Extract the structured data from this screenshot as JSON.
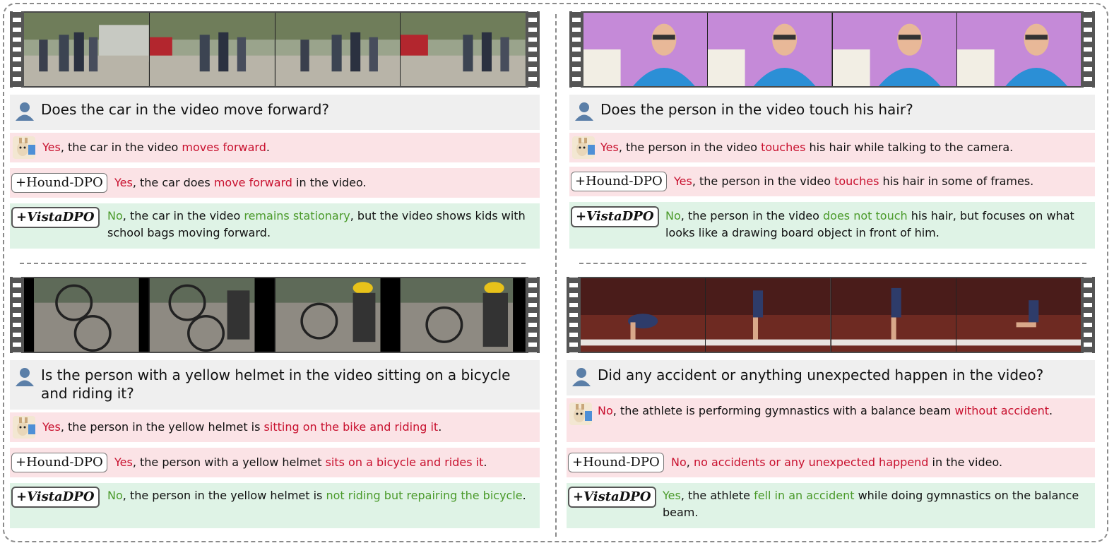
{
  "tags": {
    "hound": "+Hound-DPO",
    "vista": "+VistaDPO"
  },
  "panels": [
    {
      "question": "Does the car in the video move forward?",
      "base": [
        {
          "t": "Yes",
          "c": "red"
        },
        {
          "t": ", the car in the video ",
          "c": ""
        },
        {
          "t": "moves forward",
          "c": "red"
        },
        {
          "t": ".",
          "c": ""
        }
      ],
      "hound": [
        {
          "t": "Yes",
          "c": "red"
        },
        {
          "t": ", the car does ",
          "c": ""
        },
        {
          "t": "move forward",
          "c": "red"
        },
        {
          "t": " in the video.",
          "c": ""
        }
      ],
      "vista": [
        {
          "t": "No",
          "c": "grn"
        },
        {
          "t": ", the car in the video ",
          "c": ""
        },
        {
          "t": "remains stationary",
          "c": "grn"
        },
        {
          "t": ", but the video shows kids with school bags moving forward.",
          "c": ""
        }
      ]
    },
    {
      "question": "Does the person in the video touch his hair?",
      "base": [
        {
          "t": "Yes",
          "c": "red"
        },
        {
          "t": ", the person in the video ",
          "c": ""
        },
        {
          "t": "touches",
          "c": "red"
        },
        {
          "t": " his hair while talking to the camera.",
          "c": ""
        }
      ],
      "hound": [
        {
          "t": "Yes",
          "c": "red"
        },
        {
          "t": ", the person in the video ",
          "c": ""
        },
        {
          "t": "touches",
          "c": "red"
        },
        {
          "t": " his hair in some of frames.",
          "c": ""
        }
      ],
      "vista": [
        {
          "t": "No",
          "c": "grn"
        },
        {
          "t": ", the person in the video ",
          "c": ""
        },
        {
          "t": "does not touch",
          "c": "grn"
        },
        {
          "t": " his hair, but focuses on what looks like a drawing board object in front of him.",
          "c": ""
        }
      ]
    },
    {
      "question": "Is the person with a yellow helmet in the video sitting on a bicycle and riding it?",
      "base": [
        {
          "t": "Yes",
          "c": "red"
        },
        {
          "t": ", the person in the yellow helmet is ",
          "c": ""
        },
        {
          "t": "sitting on the bike and riding it",
          "c": "red"
        },
        {
          "t": ".",
          "c": ""
        }
      ],
      "hound": [
        {
          "t": "Yes",
          "c": "red"
        },
        {
          "t": ", the person with a yellow helmet ",
          "c": ""
        },
        {
          "t": "sits on a bicycle and rides it",
          "c": "red"
        },
        {
          "t": ".",
          "c": ""
        }
      ],
      "vista": [
        {
          "t": "No",
          "c": "grn"
        },
        {
          "t": ", the person in the yellow helmet is ",
          "c": ""
        },
        {
          "t": "not riding but repairing the bicycle",
          "c": "grn"
        },
        {
          "t": ".",
          "c": ""
        }
      ]
    },
    {
      "question": "Did any accident or anything unexpected happen in the video?",
      "base": [
        {
          "t": "No",
          "c": "red"
        },
        {
          "t": ", the athlete is performing gymnastics with a balance beam ",
          "c": ""
        },
        {
          "t": "without accident",
          "c": "red"
        },
        {
          "t": ".",
          "c": ""
        }
      ],
      "hound": [
        {
          "t": "No",
          "c": "red"
        },
        {
          "t": ", ",
          "c": ""
        },
        {
          "t": "no accidents or any unexpected happend",
          "c": "red"
        },
        {
          "t": " in the video.",
          "c": ""
        }
      ],
      "vista": [
        {
          "t": "Yes",
          "c": "grn"
        },
        {
          "t": ", the athlete ",
          "c": ""
        },
        {
          "t": "fell in an accident",
          "c": "grn"
        },
        {
          "t": " while doing gymnastics on the balance beam.",
          "c": ""
        }
      ]
    }
  ]
}
